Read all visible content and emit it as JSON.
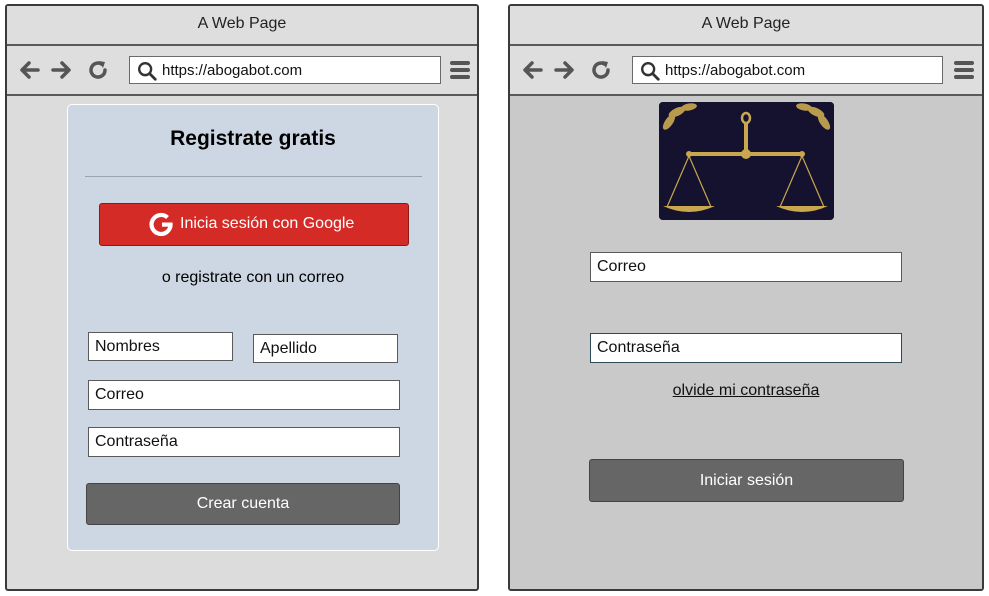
{
  "left": {
    "window_title": "A Web Page",
    "url": "https://abogabot.com",
    "card": {
      "title": "Registrate gratis",
      "google_button": "Inicia sesión con Google",
      "or_text": "o registrate con un correo",
      "first_name_field": "Nombres",
      "last_name_field": "Apellido",
      "email_field": "Correo",
      "password_field": "Contraseña",
      "submit_button": "Crear cuenta"
    }
  },
  "right": {
    "window_title": "A Web Page",
    "url": "https://abogabot.com",
    "logo": "scales-of-justice-logo",
    "email_field": "Correo",
    "password_field": "Contraseña",
    "forgot_link": "olvide mi contraseña",
    "login_button": "Iniciar sesión"
  },
  "colors": {
    "google_red": "#d52b27",
    "card_bg": "#cdd7e3",
    "button_gray": "#666666",
    "window_bg": "#dcdcdc"
  }
}
